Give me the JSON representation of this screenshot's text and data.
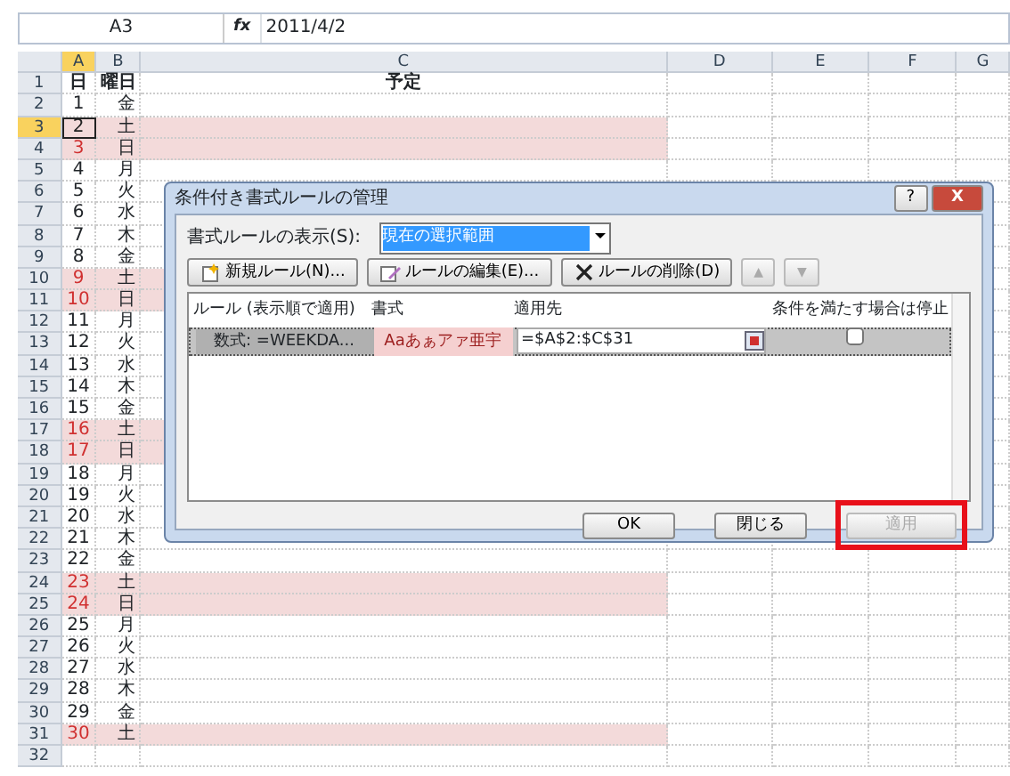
{
  "formula_bar": {
    "name_box": "A3",
    "fx": "fx",
    "formula": "2011/4/2"
  },
  "columns": [
    {
      "label": "A",
      "selected": true
    },
    {
      "label": "B",
      "selected": false
    },
    {
      "label": "C",
      "selected": false
    },
    {
      "label": "D",
      "selected": false
    },
    {
      "label": "E",
      "selected": false
    },
    {
      "label": "F",
      "selected": false
    },
    {
      "label": "G",
      "selected": false
    }
  ],
  "rows": [
    {
      "num": "1",
      "cells": [
        "日",
        "曜日",
        "予定"
      ],
      "weekend": false,
      "selected": false,
      "header": true
    },
    {
      "num": "2",
      "cells": [
        "1",
        "金"
      ],
      "weekend": false,
      "selected": false
    },
    {
      "num": "3",
      "cells": [
        "2",
        "土"
      ],
      "weekend": true,
      "selected": true
    },
    {
      "num": "4",
      "cells": [
        "3",
        "日"
      ],
      "weekend": true,
      "selected": false
    },
    {
      "num": "5",
      "cells": [
        "4",
        "月"
      ],
      "weekend": false,
      "selected": false
    },
    {
      "num": "6",
      "cells": [
        "5",
        "火"
      ],
      "weekend": false,
      "selected": false
    },
    {
      "num": "7",
      "cells": [
        "6",
        "水"
      ],
      "weekend": false,
      "selected": false
    },
    {
      "num": "8",
      "cells": [
        "7",
        "木"
      ],
      "weekend": false,
      "selected": false
    },
    {
      "num": "9",
      "cells": [
        "8",
        "金"
      ],
      "weekend": false,
      "selected": false
    },
    {
      "num": "10",
      "cells": [
        "9",
        "土"
      ],
      "weekend": true,
      "selected": false
    },
    {
      "num": "11",
      "cells": [
        "10",
        "日"
      ],
      "weekend": true,
      "selected": false
    },
    {
      "num": "12",
      "cells": [
        "11",
        "月"
      ],
      "weekend": false,
      "selected": false
    },
    {
      "num": "13",
      "cells": [
        "12",
        "火"
      ],
      "weekend": false,
      "selected": false
    },
    {
      "num": "14",
      "cells": [
        "13",
        "水"
      ],
      "weekend": false,
      "selected": false
    },
    {
      "num": "15",
      "cells": [
        "14",
        "木"
      ],
      "weekend": false,
      "selected": false
    },
    {
      "num": "16",
      "cells": [
        "15",
        "金"
      ],
      "weekend": false,
      "selected": false
    },
    {
      "num": "17",
      "cells": [
        "16",
        "土"
      ],
      "weekend": true,
      "selected": false
    },
    {
      "num": "18",
      "cells": [
        "17",
        "日"
      ],
      "weekend": true,
      "selected": false
    },
    {
      "num": "19",
      "cells": [
        "18",
        "月"
      ],
      "weekend": false,
      "selected": false
    },
    {
      "num": "20",
      "cells": [
        "19",
        "火"
      ],
      "weekend": false,
      "selected": false
    },
    {
      "num": "21",
      "cells": [
        "20",
        "水"
      ],
      "weekend": false,
      "selected": false
    },
    {
      "num": "22",
      "cells": [
        "21",
        "木"
      ],
      "weekend": false,
      "selected": false
    },
    {
      "num": "23",
      "cells": [
        "22",
        "金"
      ],
      "weekend": false,
      "selected": false
    },
    {
      "num": "24",
      "cells": [
        "23",
        "土"
      ],
      "weekend": true,
      "selected": false
    },
    {
      "num": "25",
      "cells": [
        "24",
        "日"
      ],
      "weekend": true,
      "selected": false
    },
    {
      "num": "26",
      "cells": [
        "25",
        "月"
      ],
      "weekend": false,
      "selected": false
    },
    {
      "num": "27",
      "cells": [
        "26",
        "火"
      ],
      "weekend": false,
      "selected": false
    },
    {
      "num": "28",
      "cells": [
        "27",
        "水"
      ],
      "weekend": false,
      "selected": false
    },
    {
      "num": "29",
      "cells": [
        "28",
        "木"
      ],
      "weekend": false,
      "selected": false
    },
    {
      "num": "30",
      "cells": [
        "29",
        "金"
      ],
      "weekend": false,
      "selected": false
    },
    {
      "num": "31",
      "cells": [
        "30",
        "土"
      ],
      "weekend": true,
      "selected": false
    },
    {
      "num": "32",
      "cells": [],
      "weekend": false,
      "selected": false
    }
  ],
  "dialog": {
    "title": "条件付き書式ルールの管理",
    "help": "?",
    "close": "X",
    "show_label": "書式ルールの表示(S):",
    "show_value": "現在の選択範囲",
    "toolbar": [
      {
        "label": "新規ルール(N)...",
        "kind": "new",
        "disabled": false
      },
      {
        "label": "ルールの編集(E)...",
        "kind": "edit",
        "disabled": false
      },
      {
        "label": "ルールの削除(D)",
        "kind": "delete",
        "disabled": false
      },
      {
        "label": "▲",
        "kind": "arrow",
        "disabled": true
      },
      {
        "label": "▼",
        "kind": "arrow",
        "disabled": true
      }
    ],
    "list_columns": [
      "ルール (表示順で適用)",
      "書式",
      "適用先",
      "条件を満たす場合は停止"
    ],
    "rules": [
      {
        "rule": "数式: =WEEKDA...",
        "format_preview": "Aaあぁアァ亜宇",
        "applies_to": "=$A$2:$C$31",
        "stop_if_true": false,
        "selected": true
      }
    ],
    "buttons": [
      {
        "label": "OK",
        "disabled": false,
        "highlighted": false
      },
      {
        "label": "閉じる",
        "disabled": false,
        "highlighted": false
      },
      {
        "label": "適用",
        "disabled": true,
        "highlighted": true
      }
    ]
  }
}
